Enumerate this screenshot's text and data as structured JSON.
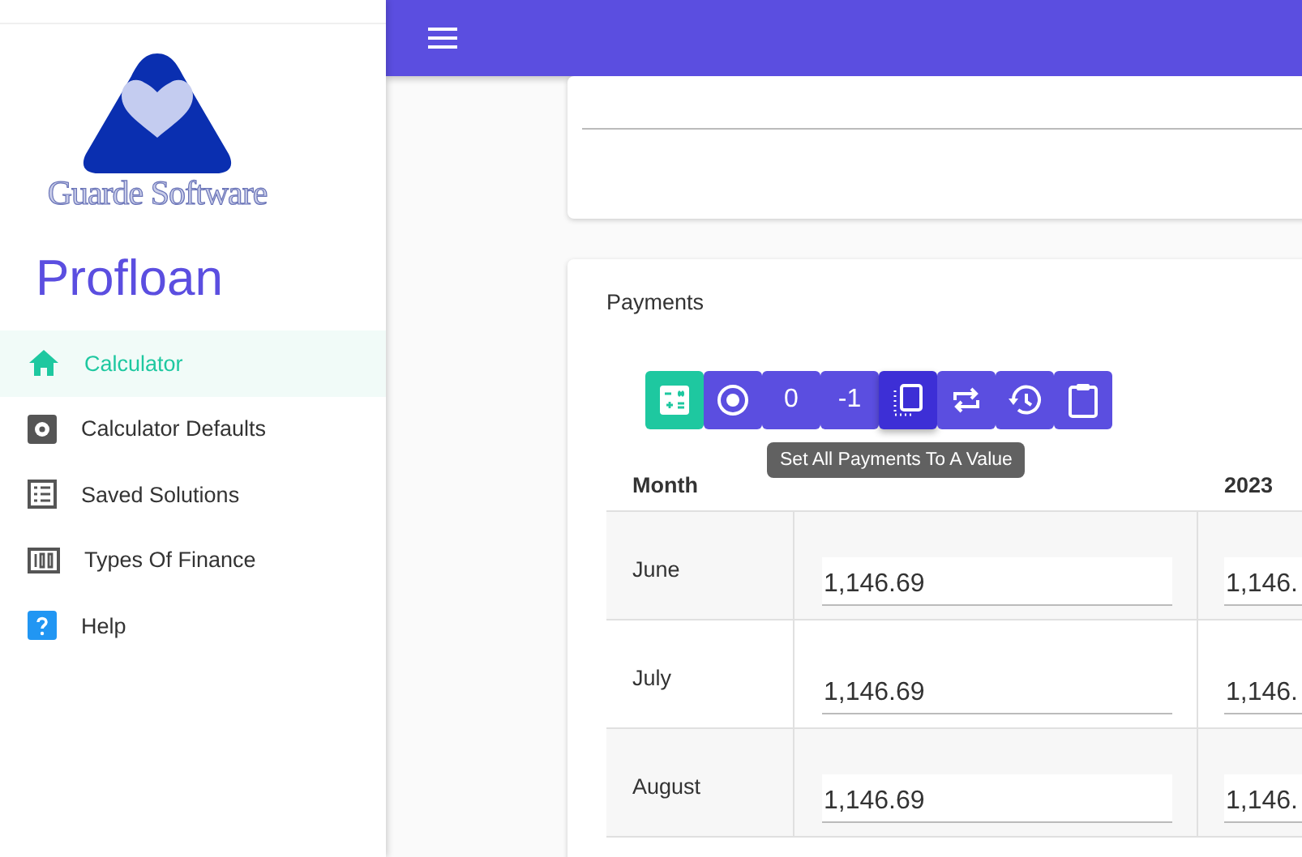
{
  "brand": {
    "logo_text": "Guarde Software",
    "app_name": "Profloan"
  },
  "nav": [
    {
      "label": "Calculator",
      "selected": true
    },
    {
      "label": "Calculator Defaults",
      "selected": false
    },
    {
      "label": "Saved Solutions",
      "selected": false
    },
    {
      "label": "Types Of Finance",
      "selected": false
    },
    {
      "label": "Help",
      "selected": false
    }
  ],
  "payments": {
    "title": "Payments",
    "toolbar": [
      {
        "kind": "icon",
        "color": "#1ec8a0",
        "selected": false
      },
      {
        "kind": "icon",
        "color": "#5b4ee0",
        "selected": false
      },
      {
        "kind": "text",
        "label": "0",
        "color": "#5b4ee0",
        "selected": false
      },
      {
        "kind": "text",
        "label": "-1",
        "color": "#5b4ee0",
        "selected": false
      },
      {
        "kind": "icon",
        "color": "#3d2fd6",
        "selected": true
      },
      {
        "kind": "icon",
        "color": "#5b4ee0",
        "selected": false
      },
      {
        "kind": "icon",
        "color": "#5b4ee0",
        "selected": false
      },
      {
        "kind": "icon",
        "color": "#5b4ee0",
        "selected": false
      }
    ],
    "tooltip": "Set All Payments To A Value",
    "columns": [
      "Month",
      "2023"
    ],
    "rows": [
      {
        "month": "June",
        "column_2": "1,146.69",
        "column_3": "1,146."
      },
      {
        "month": "July",
        "column_2": "1,146.69",
        "column_3": "1,146."
      },
      {
        "month": "August",
        "column_2": "1,146.69",
        "column_3": "1,146."
      }
    ]
  }
}
